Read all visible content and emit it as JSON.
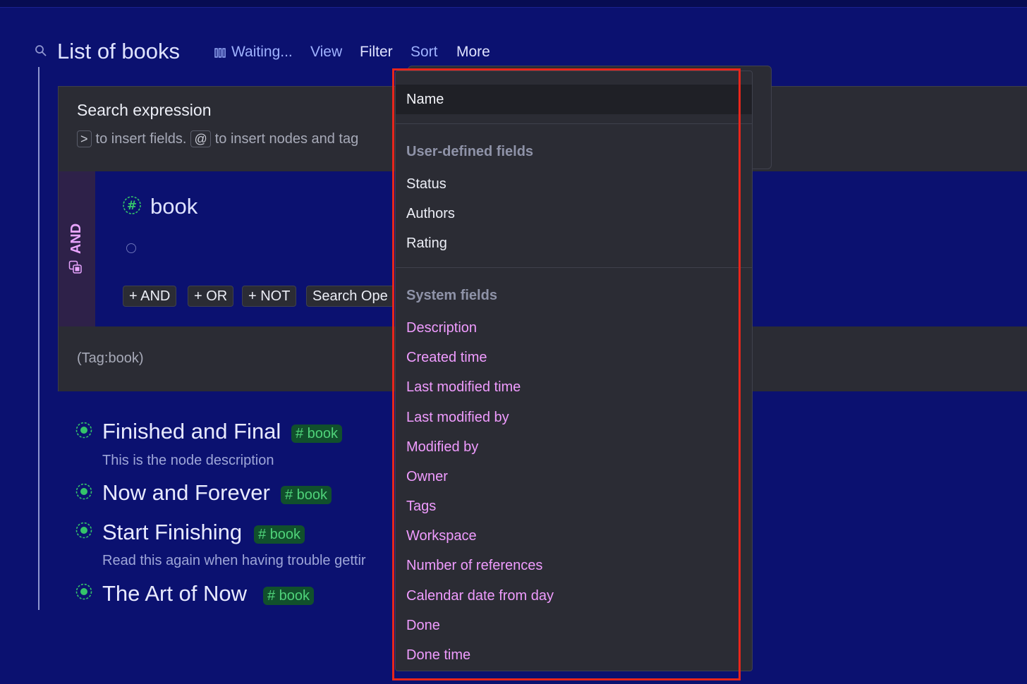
{
  "header": {
    "title": "List of books",
    "toolbar": {
      "waiting_label": "Waiting...",
      "view_label": "View",
      "filter_label": "Filter",
      "sort_label": "Sort",
      "more_label": "More"
    }
  },
  "search_panel": {
    "title": "Search expression",
    "hint": {
      "key_fields": ">",
      "text_fields": "to insert fields.",
      "key_nodes": "@",
      "text_nodes": "to insert nodes and tag"
    },
    "group_operator": "AND",
    "tag_name": "book",
    "buttons": {
      "and": "+ AND",
      "or": "+ OR",
      "not": "+ NOT",
      "search_operators": "Search Ope"
    },
    "query_text": "(Tag:book)"
  },
  "results": [
    {
      "title": "Finished and Final",
      "tag": "# book",
      "description": "This is the node description"
    },
    {
      "title": "Now and Forever",
      "tag": "# book",
      "description": ""
    },
    {
      "title": "Start Finishing",
      "tag": "# book",
      "description": "Read this again when having trouble gettir"
    },
    {
      "title": "The Art of Now",
      "tag": "# book",
      "description": ""
    }
  ],
  "sort_menu": {
    "selected": "Name",
    "user_section_label": "User-defined fields",
    "user_fields": [
      "Status",
      "Authors",
      "Rating"
    ],
    "system_section_label": "System fields",
    "system_fields": [
      "Description",
      "Created time",
      "Last modified time",
      "Last modified by",
      "Modified by",
      "Owner",
      "Tags",
      "Workspace",
      "Number of references",
      "Calendar date from day",
      "Done",
      "Done time"
    ]
  },
  "colors": {
    "background": "#0b1170",
    "panel": "#2b2c34",
    "link": "#9fb2ff",
    "system_field": "#f09cff",
    "tag_green": "#4fd37a",
    "highlight": "#e8261b"
  }
}
